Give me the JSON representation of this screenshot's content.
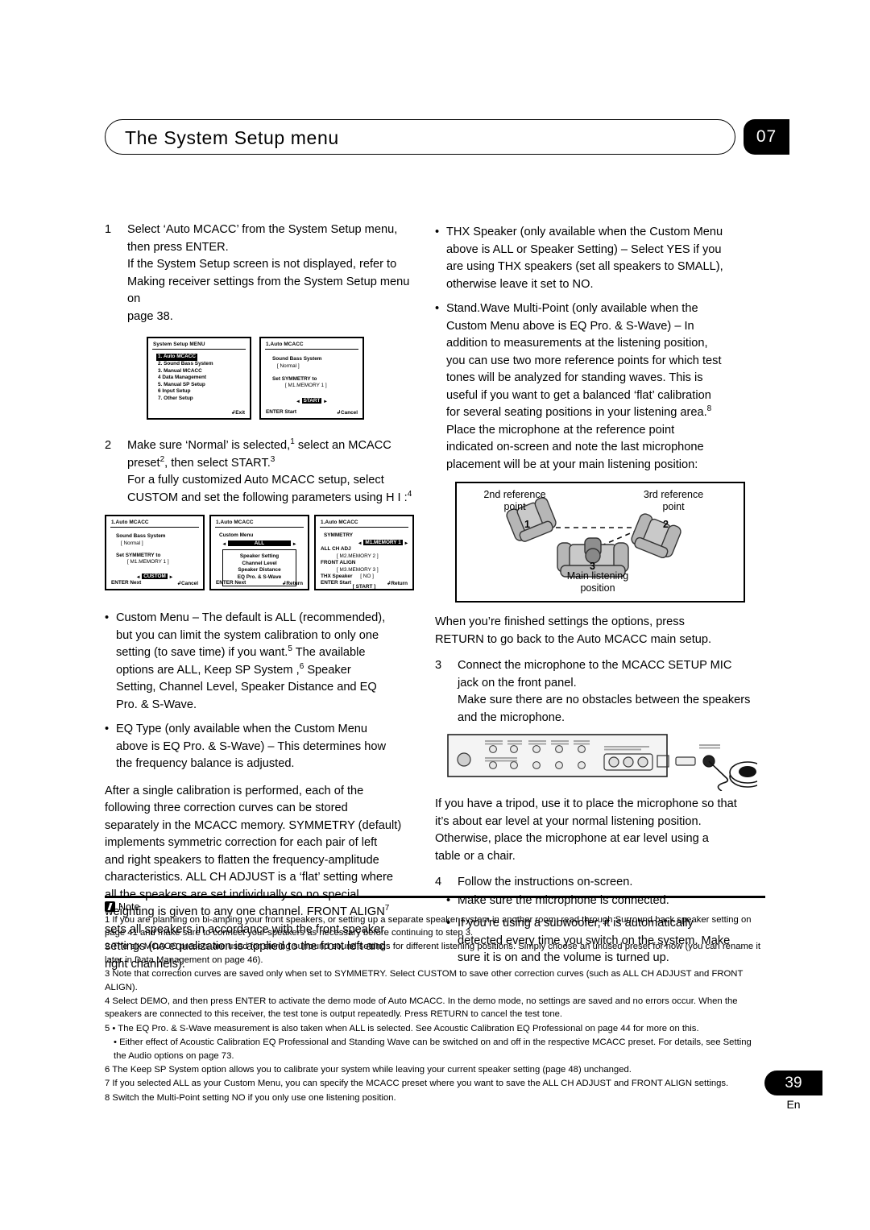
{
  "header": {
    "title": "The System Setup menu",
    "chapter": "07"
  },
  "footer": {
    "page_number": "39",
    "language": "En"
  },
  "left_column": {
    "step1": {
      "num": "1",
      "line1": "Select ‘Auto MCACC’ from the System Setup menu,",
      "line2": "then press ENTER.",
      "line3": "If the System Setup screen is not displayed, refer to",
      "line4": "Making receiver settings from the System Setup menu on",
      "line5": "page 38."
    },
    "screens_row1": [
      {
        "title": "System Setup MENU",
        "lines": [
          "1. Auto MCACC",
          "2. Sound Bass System",
          "3. Manual MCACC",
          "4 Data Management",
          "5. Manual SP Setup",
          "6 Input Setup",
          "7. Other Setup"
        ],
        "highlight_index": 0,
        "foot_left": "",
        "foot_right": "Exit"
      },
      {
        "title": "1.Auto MCACC",
        "l1": "Sound Bass System",
        "l2": "[      Normal      ]",
        "l3": "Set SYMMETRY to",
        "l4": "[ M1.MEMORY 1 ]",
        "button": "START",
        "foot_left": "ENTER Start",
        "foot_right": "Cancel"
      }
    ],
    "step2": {
      "num": "2",
      "line1": "Make sure ‘Normal’ is selected,",
      "sup1": "1",
      "line1b": "select an MCACC",
      "line2a": "preset",
      "sup2": "2",
      "line2b": ", then select START.",
      "sup3": "3",
      "line3": "For a fully customized Auto MCACC setup, select",
      "line4": "CUSTOM and set the following parameters using",
      "line4b": "H I :",
      "sup4": "4"
    },
    "screens_row2": [
      {
        "title": "1.Auto MCACC",
        "l1": "Sound Bass System",
        "l2": "[      Normal      ]",
        "l3": "Set SYMMETRY to",
        "l4": "[ M1.MEMORY 1 ]",
        "button": "CUSTOM",
        "foot_left": "ENTER Next",
        "foot_right": "Cancel"
      },
      {
        "title": "1.Auto MCACC",
        "l1": "Custom Menu",
        "button": "ALL",
        "box_lines": [
          "Speaker Setting",
          "Channel Level",
          "Speaker Distance",
          "EQ Pro. & S-Wave"
        ],
        "foot_left": "ENTER Next",
        "foot_right": "Return"
      },
      {
        "title": "1.Auto MCACC",
        "l1": "SYMMETRY",
        "sel1": "M1.MEMORY 1",
        "l2": "ALL CH ADJ",
        "sel2": "[ M2.MEMORY 2 ]",
        "l3": "FRONT ALIGN",
        "sel3": "[ M3.MEMORY 3 ]",
        "l4": "THX Speaker",
        "sel4": "[  NO  ]",
        "button": "[   START   ]",
        "foot_left": "ENTER Start",
        "foot_right": "Return"
      }
    ],
    "bullets": [
      {
        "lines": [
          "Custom Menu – The default is ALL (recommended),",
          "but you can limit the system calibration to only one",
          "setting (to save time) if you want.",
          "The available",
          "options are ALL, Keep SP System ,",
          "Speaker",
          "Setting, Channel Level, Speaker Distance and EQ",
          "Pro. & S-Wave."
        ],
        "sup_a": "5",
        "sup_b": "6"
      },
      {
        "lines": [
          "EQ Type (only available when the Custom Menu",
          "above is EQ Pro. & S-Wave) – This determines how",
          "the frequency balance is adjusted."
        ]
      }
    ],
    "para_after": {
      "line1": "After a single calibration is performed, each of the",
      "line2": "following three correction curves can be stored",
      "line3": "separately in the MCACC memory. SYMMETRY (default)",
      "line4": "implements symmetric correction for each pair of left",
      "line5": "and right speakers to flatten the frequency-amplitude",
      "line6": "characteristics. ALL CH ADJUST is a ‘flat’ setting where",
      "line7": "all the speakers are set individually so no special",
      "line8": "weighting is given to any one channel. FRONT ALIGN",
      "sup": "7",
      "line9": "sets all speakers in accordance with the front speaker",
      "line10": "settings (no equalization is applied to the front left and",
      "line11": "right channels)."
    }
  },
  "right_column": {
    "bullets": [
      {
        "lines": [
          "THX Speaker (only available when the Custom Menu",
          "above is ALL or Speaker Setting) – Select YES if you",
          "are using THX speakers (set all speakers to SMALL),",
          "otherwise leave it set to NO."
        ]
      },
      {
        "lines": [
          "Stand.Wave Multi-Point (only available when the",
          "Custom Menu above is EQ Pro. & S-Wave) – In",
          "addition to measurements at the listening position,",
          "you can use two more reference points for which test",
          "tones will be analyzed for standing waves. This is",
          "useful if you want to get a balanced ‘flat’ calibration",
          "for several seating positions in your listening area.",
          "Place the microphone at the reference point",
          "indicated on-screen and note the last microphone",
          "placement will be at your main listening position:"
        ],
        "sup": "8"
      }
    ],
    "seating_diagram": {
      "label_2nd": "2nd reference\npoint",
      "label_3rd": "3rd reference\npoint",
      "label_main": "Main listening\nposition",
      "chair1": "1",
      "chair2": "2",
      "chair3": "3"
    },
    "para_return": {
      "line1": "When you’re finished settings the options, press",
      "line2": "RETURN to go back to the Auto MCACC main setup."
    },
    "step3": {
      "num": "3",
      "line1": "Connect the microphone to the MCACC SETUP MIC",
      "line2": "jack on the front panel.",
      "line3": "Make sure there are no obstacles between the speakers",
      "line4": "and the microphone."
    },
    "para_tripod": {
      "line1": "If you have a tripod, use it to place the microphone so that",
      "line2": "it’s about ear level at your normal listening position.",
      "line3": "Otherwise, place the microphone at ear level using a",
      "line4": "table or a chair."
    },
    "step4": {
      "num": "4",
      "line1": "Follow the instructions on-screen."
    },
    "step4_bullets": [
      {
        "lines": [
          "Make sure the microphone is connected."
        ]
      },
      {
        "lines": [
          "If you’re using a subwoofer, it is automatically",
          "detected every time you switch on the system. Make",
          "sure it is on and the volume is turned up."
        ]
      }
    ]
  },
  "notes": {
    "heading": "Note",
    "items": [
      "1 If you are planning on bi-amping your front speakers, or setting up a separate speaker system in another room, read through Surround back speaker setting on page 41 and make sure to connect your speakers as necessary before continuing to step 3.",
      "2 The six MCACC presets are used for storing surround sound settings for different listening positions. Simply choose an unused preset for now (you can rename it later in Data Management on page 46).",
      "3 Note that correction curves are saved only when set to SYMMETRY. Select CUSTOM to save other correction curves (such as ALL CH ADJUST and FRONT ALIGN).",
      "4 Select DEMO, and then press ENTER to activate the demo mode of Auto MCACC. In the demo mode, no settings are saved and no errors occur. When the speakers are connected to this receiver, the test tone is output repeatedly. Press RETURN to cancel the test tone.",
      "5 • The EQ Pro. & S-Wave measurement is also taken when ALL is selected. See Acoustic Calibration EQ Professional on page 44 for more on this.",
      "• Either effect of Acoustic Calibration EQ Professional and Standing Wave can be switched on and off in the respective MCACC preset. For details, see Setting the Audio options on page 73.",
      "6 The Keep SP System option allows you to calibrate your system while leaving your current speaker setting (page 48) unchanged.",
      "7 If you selected ALL as your Custom Menu, you can specify the MCACC preset where you want to save the ALL CH ADJUST and FRONT ALIGN settings.",
      "8 Switch the Multi-Point setting NO if you only use one listening position."
    ]
  }
}
